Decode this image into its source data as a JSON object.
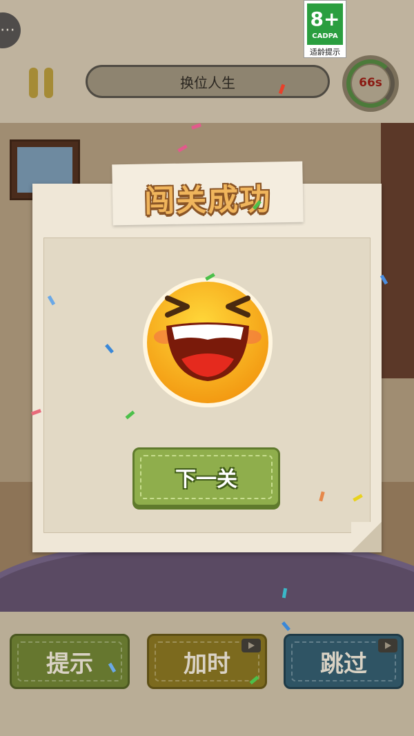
{
  "header": {
    "level_title": "换位人生",
    "timer_text": "66s",
    "age_rating": {
      "number": "8+",
      "org": "CADPA",
      "tip": "适龄提示"
    }
  },
  "dialog": {
    "title": "闯关成功",
    "next_label": "下一关"
  },
  "bottom_bar": {
    "hint_label": "提示",
    "add_time_label": "加时",
    "skip_label": "跳过"
  },
  "icons": {
    "menu": "chat-dots-icon",
    "pause": "pause-icon",
    "timer": "stopwatch-icon",
    "emoji": "laughing-face-icon",
    "video": "video-ad-icon"
  },
  "colors": {
    "success_title": "#f0b55c",
    "next_button": "#8fae4c",
    "timer_text": "#8a1a12",
    "age_badge": "#2a9e3f"
  }
}
